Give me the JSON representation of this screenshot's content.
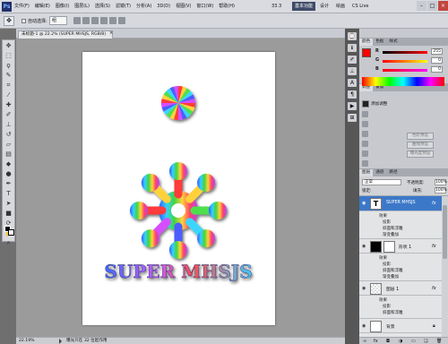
{
  "app": {
    "logo": "Ps"
  },
  "menubar": {
    "items": [
      "文件(F)",
      "编辑(E)",
      "图像(I)",
      "图层(L)",
      "选择(S)",
      "滤镜(T)",
      "分析(A)",
      "3D(D)",
      "视图(V)",
      "窗口(W)",
      "帮助(H)"
    ],
    "zoom": "33.3",
    "workspaces": [
      "基本功能",
      "设计",
      "绘画"
    ],
    "cslive": "CS Live"
  },
  "options": {
    "auto_select_label": "自动选择:",
    "auto_select_value": "组"
  },
  "document": {
    "tab_title": "未标题-1 @ 22.2% (SUPER MHSJS, RGB/8)",
    "zoom_status": "22.19%",
    "status_text": "曝光只在 32 位起作用",
    "canvas_text": "SUPER MHSJS"
  },
  "panels": {
    "color_tabs": [
      "颜色",
      "色板",
      "样式"
    ],
    "color": {
      "r": "255",
      "g": "0",
      "b": "0"
    },
    "adjust_tabs": [
      "调整",
      "蒙版"
    ],
    "adjust_heading": "添加调整",
    "preset_buttons": [
      "色阶预设",
      "曲线预设",
      "曝光度预设"
    ],
    "layer_tabs": [
      "图层",
      "通道",
      "路径"
    ],
    "blend_mode": "正常",
    "opacity_label": "不透明度:",
    "opacity": "100%",
    "lock_label": "锁定:",
    "fill_label": "填充:",
    "fill": "100%",
    "layers": [
      {
        "name": "SUPER MHSJS",
        "selected": true,
        "effects_label": "效果",
        "effects": [
          "投影",
          "斜面和浮雕",
          "渐变叠加"
        ]
      },
      {
        "name": "形状 1",
        "selected": false,
        "effects_label": "效果",
        "effects": [
          "投影",
          "斜面和浮雕",
          "渐变叠加"
        ]
      },
      {
        "name": "图层 1",
        "selected": false,
        "effects_label": "效果",
        "effects": [
          "投影",
          "斜面和浮雕"
        ]
      },
      {
        "name": "背景",
        "selected": false
      }
    ]
  },
  "colors": {
    "selection": "#3c78c8",
    "spectrum_wheel": [
      "#ff3b3b",
      "#ffd23b",
      "#4de04d",
      "#3bd6ff",
      "#4d5bff",
      "#d64dff"
    ]
  }
}
